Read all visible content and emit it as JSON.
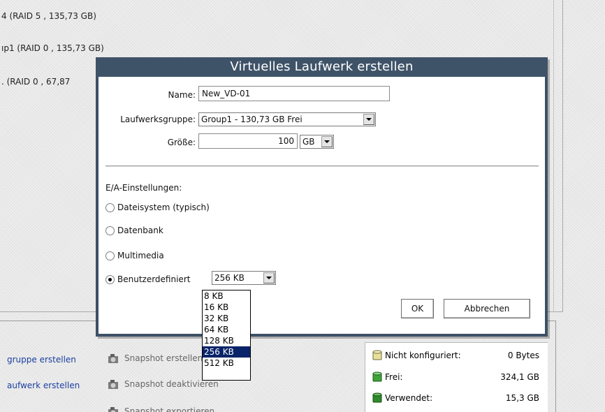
{
  "background": {
    "drive_lines": [
      "4 (RAID 5 , 135,73 GB)",
      "ıp1 (RAID 0 , 135,73 GB)",
      ". (RAID 0 , 67,87"
    ],
    "actions_left": [
      "gruppe erstellen",
      "aufwerk erstellen"
    ],
    "actions_mid": [
      "Snapshot erstellen",
      "Snapshot deaktivieren",
      "Snapshot exportieren"
    ],
    "stats": [
      {
        "label": "Nicht konfiguriert:",
        "value": "0 Bytes",
        "color": "#e8e09a"
      },
      {
        "label": "Frei:",
        "value": "324,1 GB",
        "color": "#3fa33a"
      },
      {
        "label": "Verwendet:",
        "value": "15,3 GB",
        "color": "#2f8a2b"
      }
    ]
  },
  "dialog": {
    "title": "Virtuelles Laufwerk erstellen",
    "name_label": "Name:",
    "name_value": "New_VD-01",
    "group_label": "Laufwerksgruppe:",
    "group_value": "Group1 - 130,73 GB Frei",
    "size_label": "Größe:",
    "size_value": "100",
    "size_unit": "GB",
    "io_label": "E/A-Einstellungen:",
    "io_options": [
      {
        "label": "Dateisystem (typisch)",
        "checked": false
      },
      {
        "label": "Datenbank",
        "checked": false
      },
      {
        "label": "Multimedia",
        "checked": false
      },
      {
        "label": "Benutzerdefiniert",
        "checked": true
      }
    ],
    "custom_value": "256 KB",
    "ok_label": "OK",
    "cancel_label": "Abbrechen"
  },
  "dropdown": {
    "options": [
      "8 KB",
      "16 KB",
      "32 KB",
      "64 KB",
      "128 KB",
      "256 KB",
      "512 KB"
    ],
    "selected": "256 KB"
  }
}
